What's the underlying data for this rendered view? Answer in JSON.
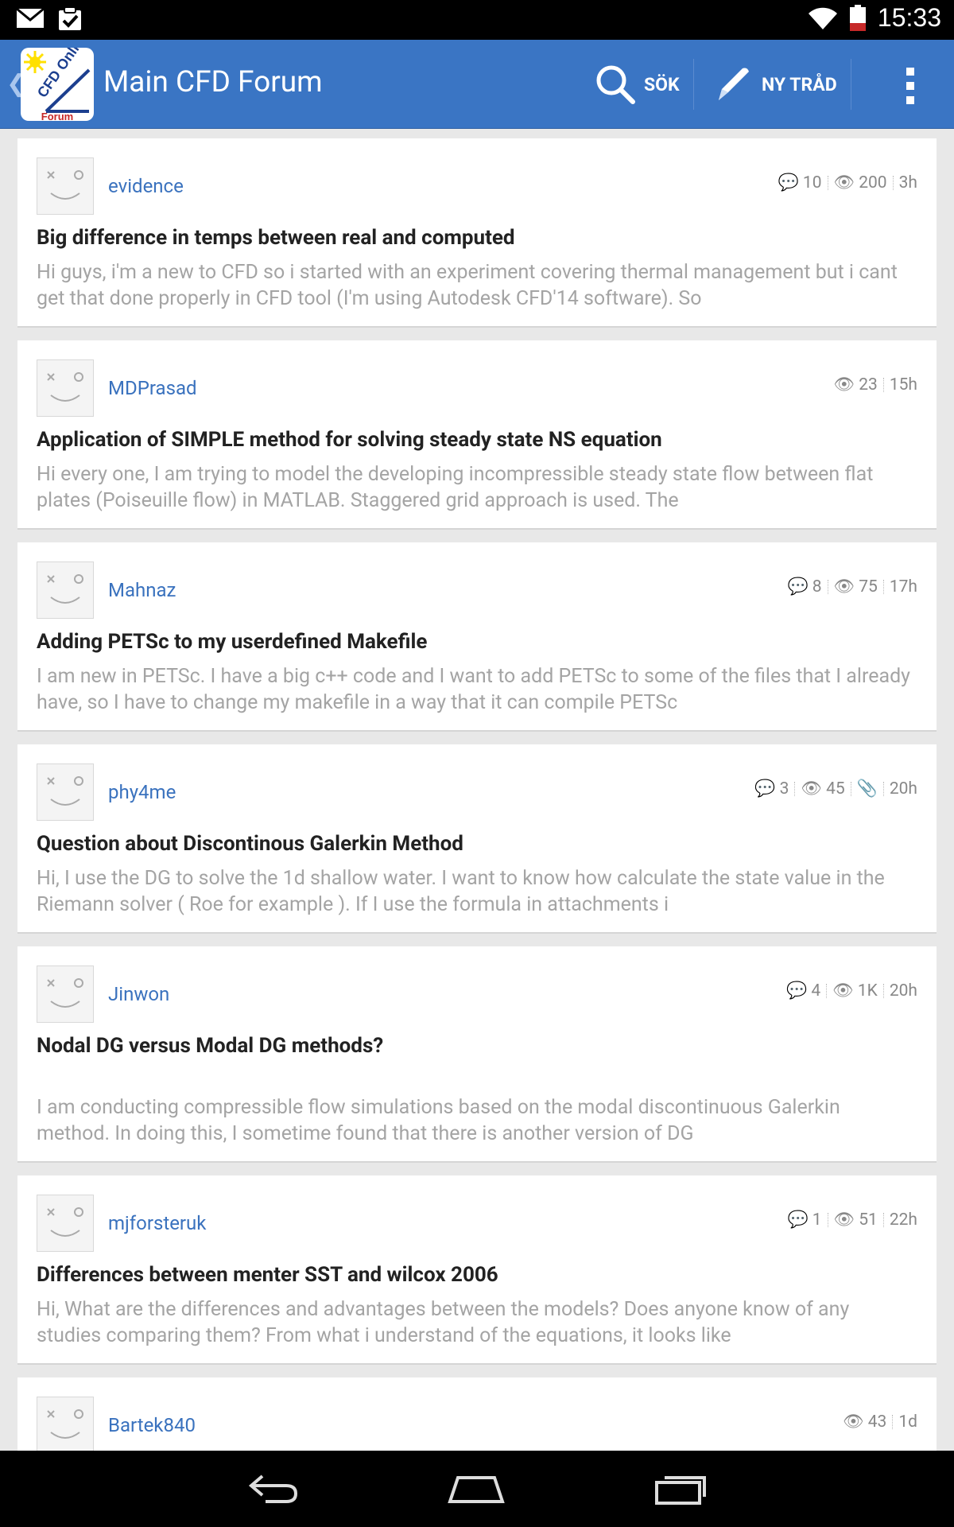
{
  "status_bar": {
    "time": "15:33"
  },
  "action_bar": {
    "logo_text": "CFD Online",
    "logo_subtext": "Forum",
    "title": "Main CFD Forum",
    "search_label": "SÖK",
    "new_thread_label": "NY TRÅD"
  },
  "threads": [
    {
      "user": "evidence",
      "replies": "10",
      "views": "200",
      "age": "3h",
      "title": "Big difference in temps between real and computed",
      "excerpt": "Hi guys, i'm a new to CFD so i started with an experiment covering thermal management but i cant get that done properly in CFD tool (I'm using Autodesk CFD'14 software). So"
    },
    {
      "user": "MDPrasad",
      "replies": "",
      "views": "23",
      "age": "15h",
      "title": "Application of SIMPLE method for solving steady state NS equation",
      "excerpt": "Hi every one, I am trying to model the developing incompressible steady state flow between flat plates (Poiseuille flow) in MATLAB. Staggered grid approach is used. The"
    },
    {
      "user": "Mahnaz",
      "replies": "8",
      "views": "75",
      "age": "17h",
      "title": "Adding PETSc to my userdefined Makefile",
      "excerpt": "I am new in PETSc. I have a big c++ code and I want to add PETSc to some of the files that I already have, so I have to change my makefile in a way that it can compile PETSc"
    },
    {
      "user": "phy4me",
      "replies": "3",
      "views": "45",
      "age": "20h",
      "attachment": true,
      "title": "Question about Discontinous Galerkin Method",
      "excerpt": "Hi, I use the DG to solve the 1d shallow water. I want to know how calculate the state value in the Riemann solver ( Roe for example ). If I use the formula in attachments i"
    },
    {
      "user": "Jinwon",
      "replies": "4",
      "views": "1K",
      "age": "20h",
      "title": "Nodal DG versus Modal DG methods?",
      "excerpt": "I am conducting compressible flow simulations based on the modal discontinuous Galerkin method. In doing this, I sometime found that there is another version of DG"
    },
    {
      "user": "mjforsteruk",
      "replies": "1",
      "views": "51",
      "age": "22h",
      "title": "Differences between menter SST and wilcox 2006",
      "excerpt": "Hi, What are the differences and advantages between the models? Does anyone know of any studies comparing them? From what i understand of the equations, it looks like"
    },
    {
      "user": "Bartek840",
      "replies": "",
      "views": "43",
      "age": "1d",
      "title": "",
      "excerpt": ""
    }
  ]
}
